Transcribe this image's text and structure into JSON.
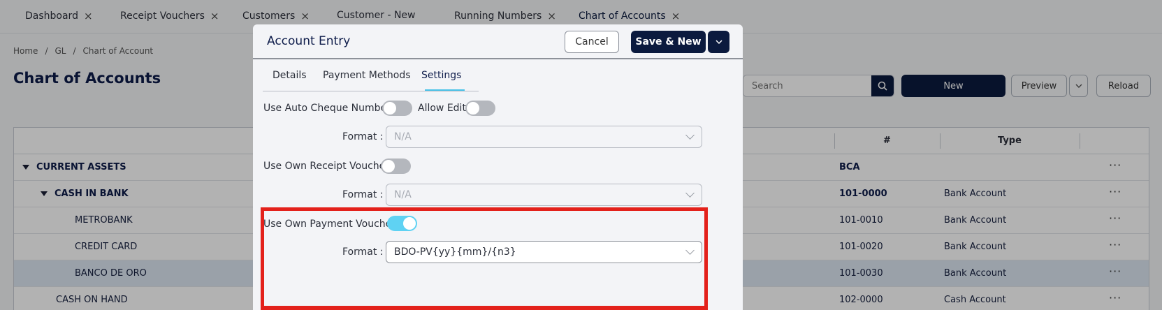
{
  "tabs": [
    {
      "label": "Dashboard",
      "closable": true
    },
    {
      "label": "Receipt Vouchers",
      "closable": true
    },
    {
      "label": "Customers",
      "closable": true
    },
    {
      "label": "Customer - New",
      "closable": false
    },
    {
      "label": "Running Numbers",
      "closable": true
    },
    {
      "label": "Chart of Accounts",
      "closable": true,
      "active": true
    }
  ],
  "close_glyph": "×",
  "breadcrumb": [
    "Home",
    "/",
    "GL",
    "/",
    "Chart of Account"
  ],
  "page_title": "Chart of Accounts",
  "toolbar": {
    "search_placeholder": "Search",
    "new_label": "New",
    "preview_label": "Preview",
    "reload_label": "Reload"
  },
  "table": {
    "columns": [
      "#",
      "Type"
    ],
    "row_actions_glyph": "···",
    "rows": [
      {
        "name": "CURRENT ASSETS",
        "code": "BCA",
        "type": "",
        "level": 0,
        "bold": true,
        "expanded": true
      },
      {
        "name": "CASH IN BANK",
        "code": "101-0000",
        "type": "Bank Account",
        "level": 1,
        "bold": true,
        "expanded": true
      },
      {
        "name": "METROBANK",
        "code": "101-0010",
        "type": "Bank Account",
        "level": 2,
        "bold": false
      },
      {
        "name": "CREDIT CARD",
        "code": "101-0020",
        "type": "Bank Account",
        "level": 2,
        "bold": false
      },
      {
        "name": "BANCO DE ORO",
        "code": "101-0030",
        "type": "Bank Account",
        "level": 2,
        "bold": false,
        "selected": true
      },
      {
        "name": "CASH ON HAND",
        "code": "102-0000",
        "type": "Cash Account",
        "level": 1,
        "bold": false
      }
    ]
  },
  "modal": {
    "title": "Account Entry",
    "cancel_label": "Cancel",
    "save_label": "Save & New",
    "tabs": [
      "Details",
      "Payment Methods",
      "Settings"
    ],
    "active_tab": "Settings",
    "settings": {
      "auto_cheque_label": "Use Auto Cheque Number:",
      "auto_cheque_on": false,
      "allow_edit_label": "Allow Edit:",
      "allow_edit_on": false,
      "format_label": "Format :",
      "auto_cheque_format": "N/A",
      "own_receipt_label": "Use Own Receipt Voucher:",
      "own_receipt_on": false,
      "own_receipt_format": "N/A",
      "own_payment_label": "Use Own Payment Voucher:",
      "own_payment_on": true,
      "own_payment_format": "BDO-PV{yy}{mm}/{n3}"
    }
  },
  "colors": {
    "primary": "#0b1a3e",
    "toggle_on": "#5fd2f3",
    "tab_underline": "#47c2e8",
    "highlight_border": "#e3211b",
    "selected_row": "#dde7f3"
  }
}
